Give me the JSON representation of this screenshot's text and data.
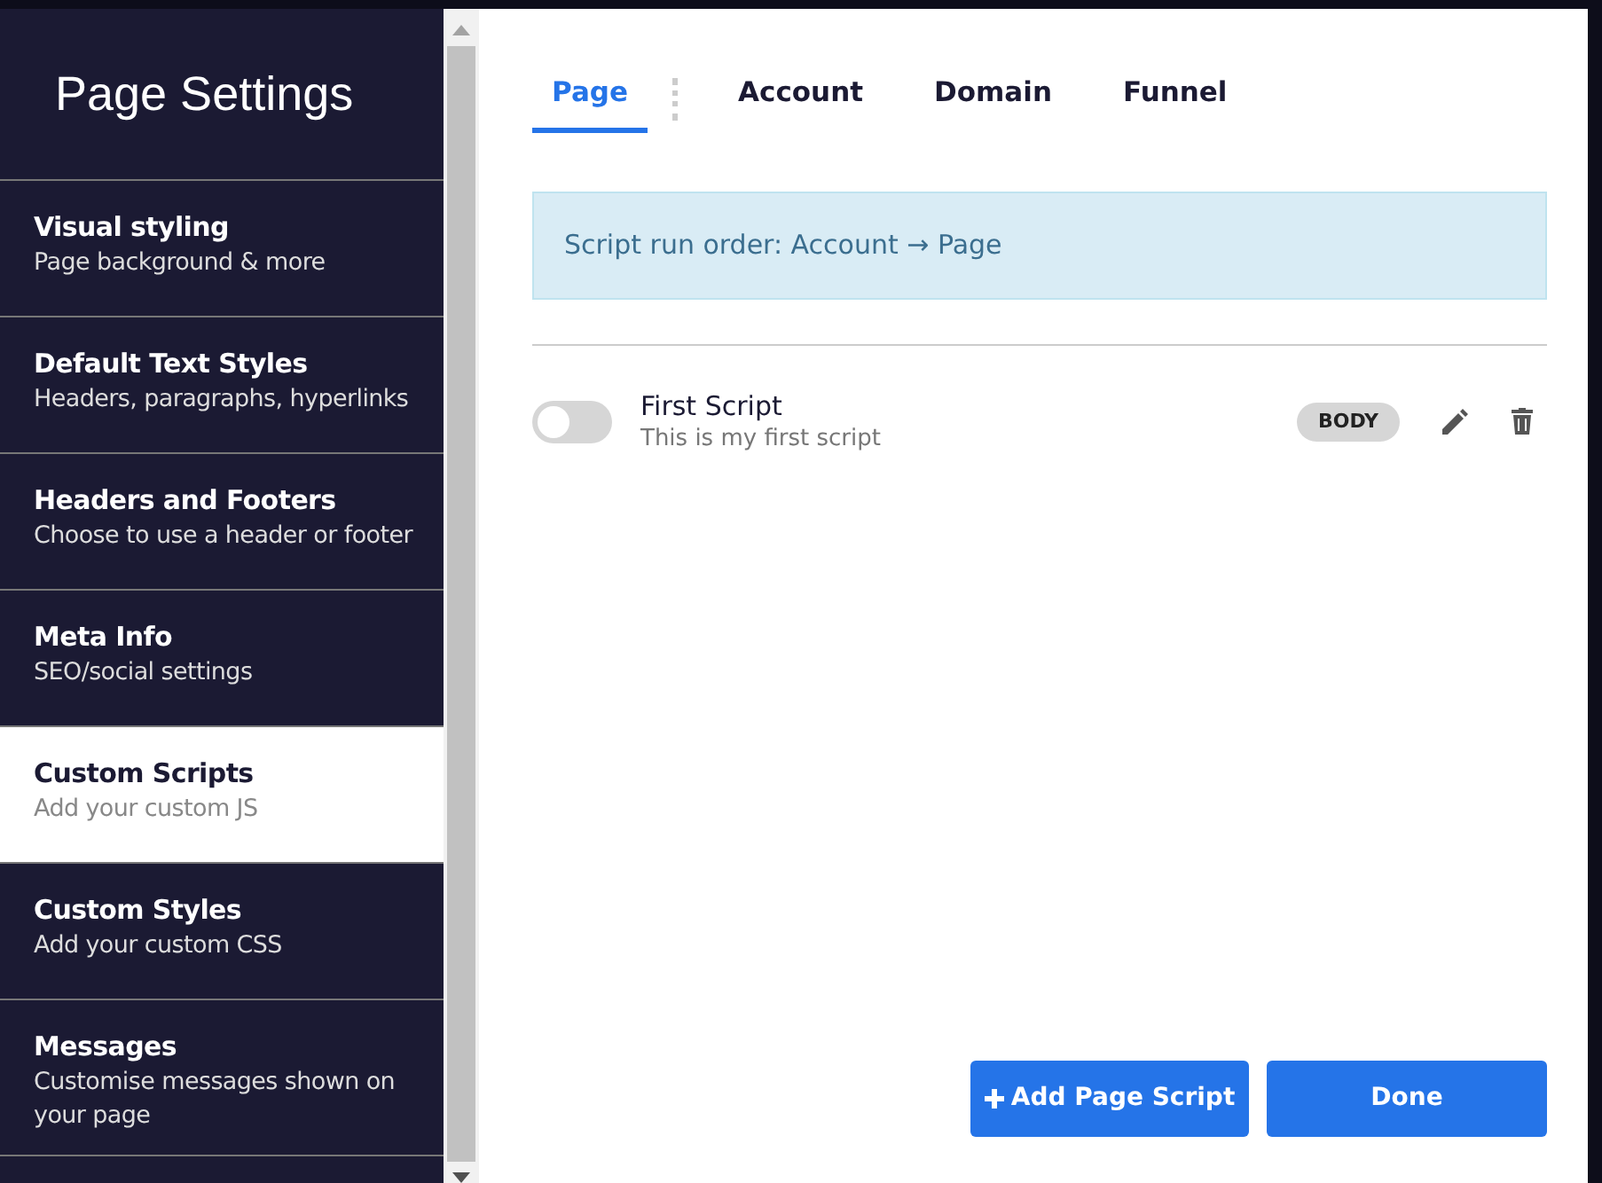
{
  "sidebar": {
    "title": "Page Settings",
    "items": [
      {
        "title": "Visual styling",
        "subtitle": "Page background & more",
        "selected": false
      },
      {
        "title": "Default Text Styles",
        "subtitle": "Headers, paragraphs, hyperlinks",
        "selected": false
      },
      {
        "title": "Headers and Footers",
        "subtitle": "Choose to use a header or footer",
        "selected": false
      },
      {
        "title": "Meta Info",
        "subtitle": "SEO/social settings",
        "selected": false
      },
      {
        "title": "Custom Scripts",
        "subtitle": "Add your custom JS",
        "selected": true
      },
      {
        "title": "Custom Styles",
        "subtitle": "Add your custom CSS",
        "selected": false
      },
      {
        "title": "Messages",
        "subtitle": "Customise messages shown on your page",
        "selected": false
      }
    ]
  },
  "tabs": [
    {
      "label": "Page",
      "selected": true
    },
    {
      "label": "Account",
      "selected": false
    },
    {
      "label": "Domain",
      "selected": false
    },
    {
      "label": "Funnel",
      "selected": false
    }
  ],
  "info": "Script run order: Account → Page",
  "scripts": [
    {
      "name": "First Script",
      "description": "This is my first script",
      "on": false,
      "tag": "BODY"
    }
  ],
  "buttons": {
    "add": "Add Page Script",
    "done": "Done"
  }
}
